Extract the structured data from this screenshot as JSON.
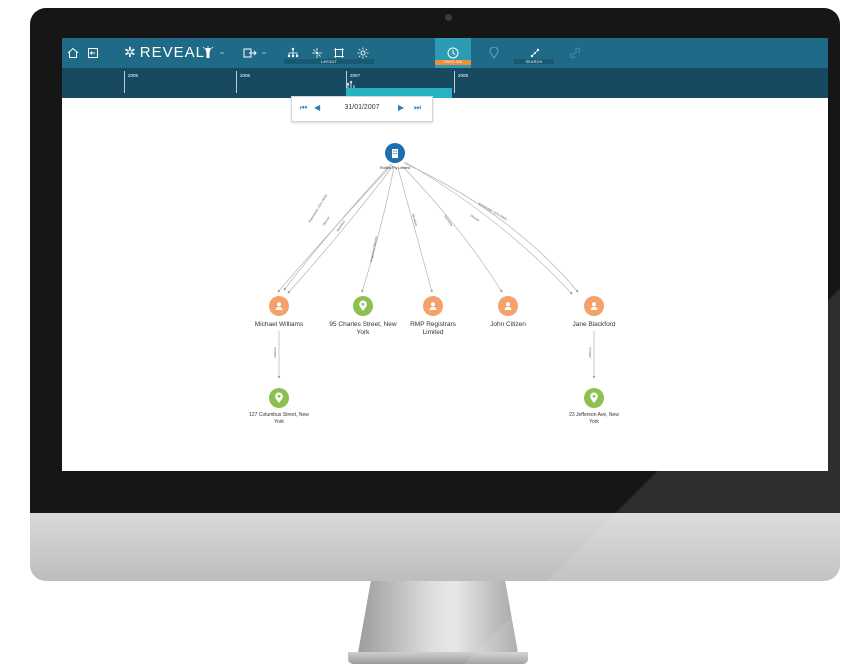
{
  "app": {
    "brand_name": "REVEAL",
    "colors": {
      "toolbar_bg": "#1f6a86",
      "timeline_bg": "#174a60",
      "timeline_range": "#27b3c4",
      "active_tab_accent": "#ee8d3a",
      "org_node": "#1f6eb0",
      "person_node": "#f4a26a",
      "place_node": "#8cc152"
    }
  },
  "toolbar": {
    "icons": [
      "home-icon",
      "exit-icon",
      "flashlight-icon",
      "export-icon",
      "hierarchy-icon",
      "radial-icon",
      "frame-icon",
      "sun-icon",
      "timeline-icon",
      "location-icon",
      "search-icon",
      "link-icon"
    ],
    "groups": {
      "layout": "LAYOUT",
      "timeline": "TIMELINE",
      "search": "SEARCH"
    }
  },
  "timeline": {
    "years": [
      "2005",
      "2006",
      "2007",
      "2008"
    ],
    "current_date": "31/01/2007"
  },
  "graph": {
    "root": {
      "label": "Robins Pty Limited",
      "type": "org"
    },
    "nodes": [
      {
        "label": "Michael Williams",
        "type": "person"
      },
      {
        "label": "95 Charles Street, New York",
        "type": "place"
      },
      {
        "label": "RMP Registrars Limited",
        "type": "person"
      },
      {
        "label": "John Citizen",
        "type": "person"
      },
      {
        "label": "Jane Blackford",
        "type": "person"
      },
      {
        "label": "127 Columbus Street, New York",
        "type": "place"
      },
      {
        "label": "23 Jefferson Ave, New York",
        "type": "place"
      }
    ],
    "edge_labels": [
      "Shareholder (15% ORD)",
      "Director",
      "Secretary",
      "Registered Address",
      "Secretary",
      "Secretary",
      "Shareholder (10% ORD)",
      "Director",
      "Address",
      "Address"
    ]
  }
}
